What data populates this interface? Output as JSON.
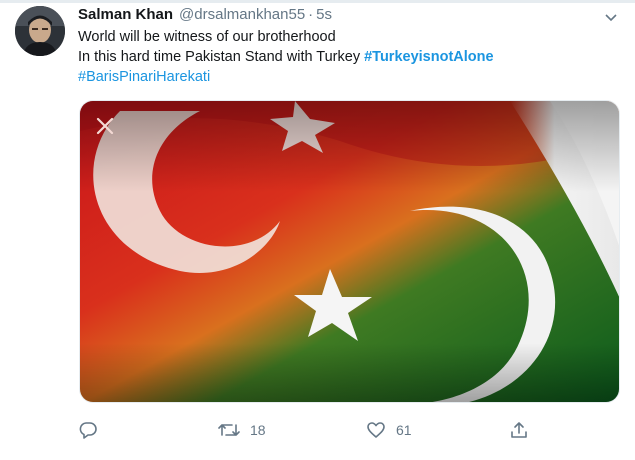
{
  "tweet": {
    "display_name": "Salman Khan",
    "handle": "@drsalmankhan55",
    "separator": "·",
    "time": "5s",
    "line1": "World will be witness of our brotherhood",
    "line2_text": "In this hard time Pakistan Stand with Turkey ",
    "hashtag1": "#TurkeyisnotAlone",
    "hashtag2": "#BarisPinariHarekati"
  },
  "media": {
    "description_icon": "close-icon",
    "flag_colors": {
      "turkey_red": "#d8201e",
      "pakistan_green": "#0b6b22",
      "white": "#f4f4f4"
    }
  },
  "actions": {
    "reply_count": "",
    "retweet_count": "18",
    "like_count": "61",
    "icons": [
      "reply-icon",
      "retweet-icon",
      "like-icon",
      "share-icon"
    ]
  },
  "colors": {
    "link": "#1b95e0",
    "secondary_text": "#657786"
  }
}
